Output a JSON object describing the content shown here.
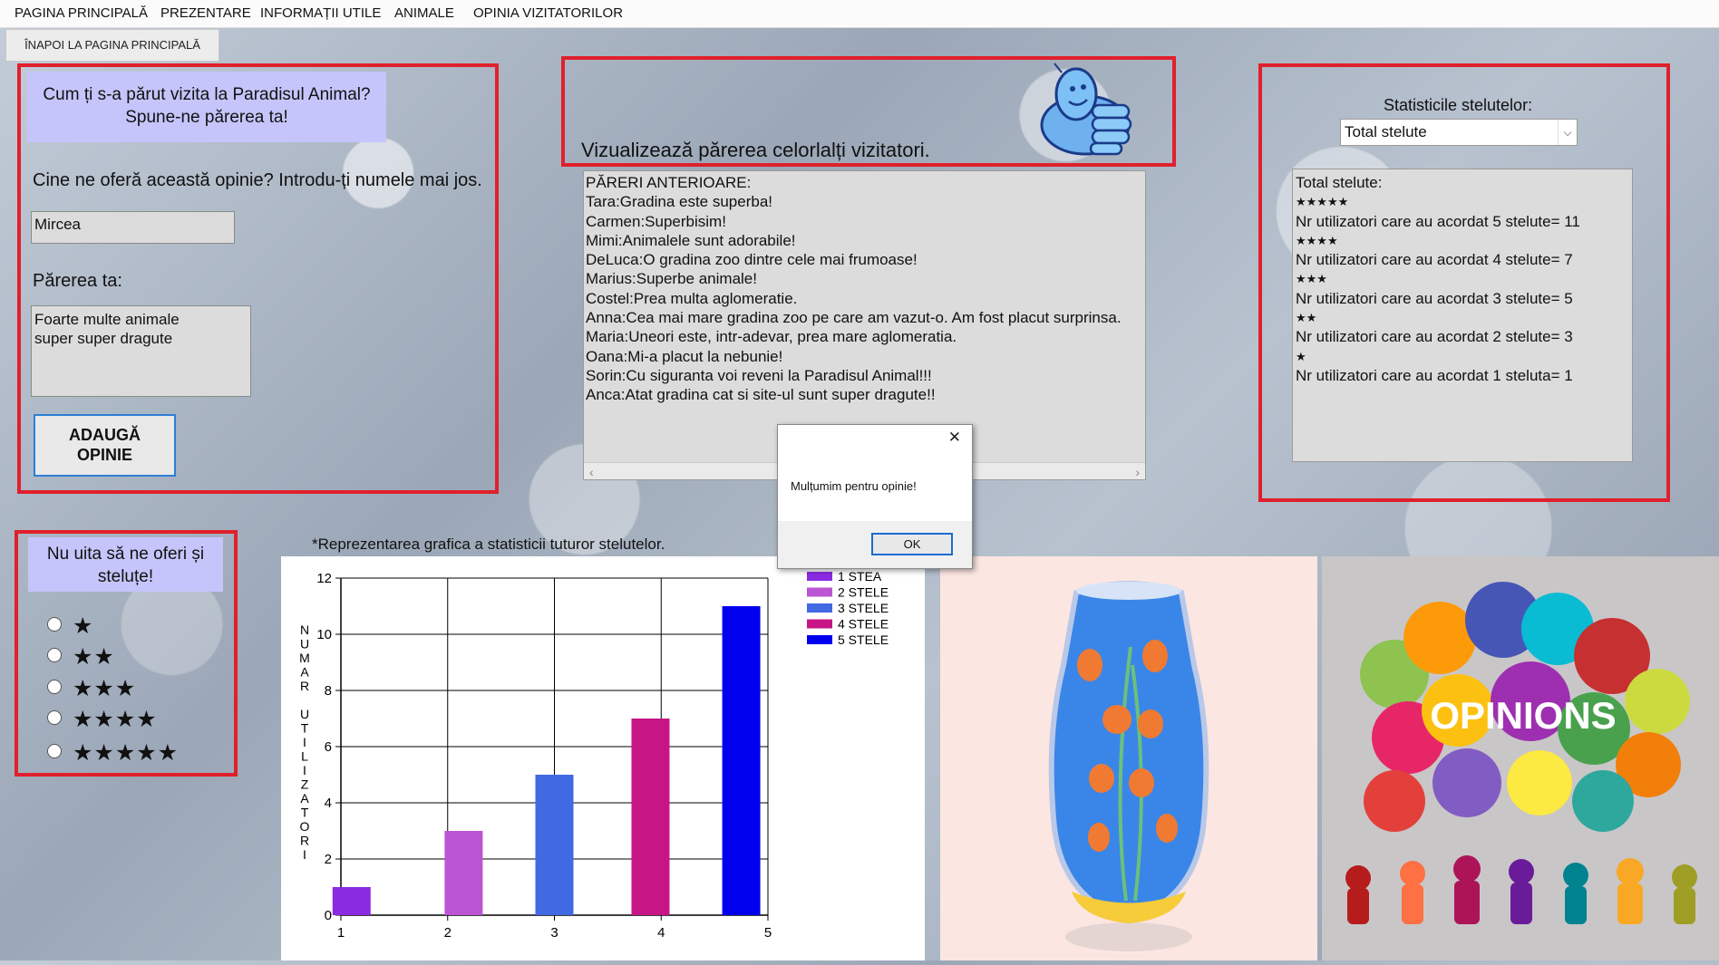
{
  "menu": [
    "PAGINA PRINCIPALĂ",
    "PREZENTARE",
    "INFORMAȚII UTILE",
    "ANIMALE",
    "OPINIA VIZITATORILOR"
  ],
  "back_button": "ÎNAPOI LA PAGINA PRINCIPALĂ",
  "opinion_form": {
    "prompt_line1": "Cum ți s-a părut vizita la Paradisul Animal?",
    "prompt_line2": "Spune-ne părerea ta!",
    "name_label": "Cine ne oferă această opinie? Introdu-ți numele mai jos.",
    "name_value": "Mircea",
    "opinion_label": "Părerea ta:",
    "opinion_line1": "Foarte multe animale",
    "opinion_line2": "super super dragute",
    "add_button_line1": "ADAUGĂ",
    "add_button_line2": "OPINIE"
  },
  "previous_opinions": {
    "header": "Vizualizează părerea celorlalți vizitatori.",
    "lines": [
      "PĂRERI ANTERIOARE:",
      "Tara:Gradina este superba!",
      "Carmen:Superbisim!",
      "Mimi:Animalele sunt adorabile!",
      "DeLuca:O gradina zoo dintre cele mai frumoase!",
      "Marius:Superbe animale!",
      "Costel:Prea multa aglomeratie.",
      "Anna:Cea mai mare gradina zoo pe care am vazut-o. Am fost placut surprinsa.",
      "Maria:Uneori este, intr-adevar, prea mare aglomeratia.",
      "Oana:Mi-a placut la nebunie!",
      "Sorin:Cu siguranta voi reveni la Paradisul Animal!!!",
      "Anca:Atat gradina cat si site-ul sunt super dragute!!"
    ]
  },
  "stats": {
    "label": "Statisticile stelutelor:",
    "selected": "Total stelute",
    "lines": [
      "Total stelute:",
      "★★★★★",
      "Nr utilizatori care au acordat 5 stelute= 11",
      "★★★★",
      "Nr utilizatori care au acordat 4 stelute= 7",
      "★★★",
      "Nr utilizatori care au acordat 3 stelute= 5",
      "★★",
      "Nr utilizatori care au acordat 2 stelute= 3",
      "★",
      "Nr utilizatori care au acordat 1 steluta= 1"
    ]
  },
  "rating": {
    "prompt_line1": "Nu uita să ne oferi și",
    "prompt_line2": "steluțe!",
    "options": [
      "★",
      "★★",
      "★★★",
      "★★★★",
      "★★★★★"
    ]
  },
  "dialog": {
    "message": "Mulțumim pentru opinie!",
    "ok_label": "OK",
    "close_glyph": "✕"
  },
  "chart_caption": "*Reprezentarea grafica a statisticii tuturor stelutelor.",
  "chart_data": {
    "type": "bar",
    "x": [
      1,
      2,
      3,
      4,
      5
    ],
    "xlim": [
      1,
      5
    ],
    "xticks": [
      1,
      2,
      3,
      4,
      5
    ],
    "ylim": [
      0,
      12
    ],
    "yticks": [
      0,
      2,
      4,
      6,
      8,
      10,
      12
    ],
    "ylabel": "NUMAR UTILIZATORI",
    "grid": true,
    "legend_position": "top-right",
    "series": [
      {
        "name": "1 STEA",
        "x": 1.1,
        "value": 1,
        "color": "#8a2be2"
      },
      {
        "name": "2 STELE",
        "x": 2.15,
        "value": 3,
        "color": "#ba55d3"
      },
      {
        "name": "3 STELE",
        "x": 3.0,
        "value": 5,
        "color": "#4169e1"
      },
      {
        "name": "4 STELE",
        "x": 3.9,
        "value": 7,
        "color": "#c71585"
      },
      {
        "name": "5 STELE",
        "x": 4.75,
        "value": 11,
        "color": "#0000ee"
      }
    ]
  },
  "opinions_image_text": "OPINIONS"
}
